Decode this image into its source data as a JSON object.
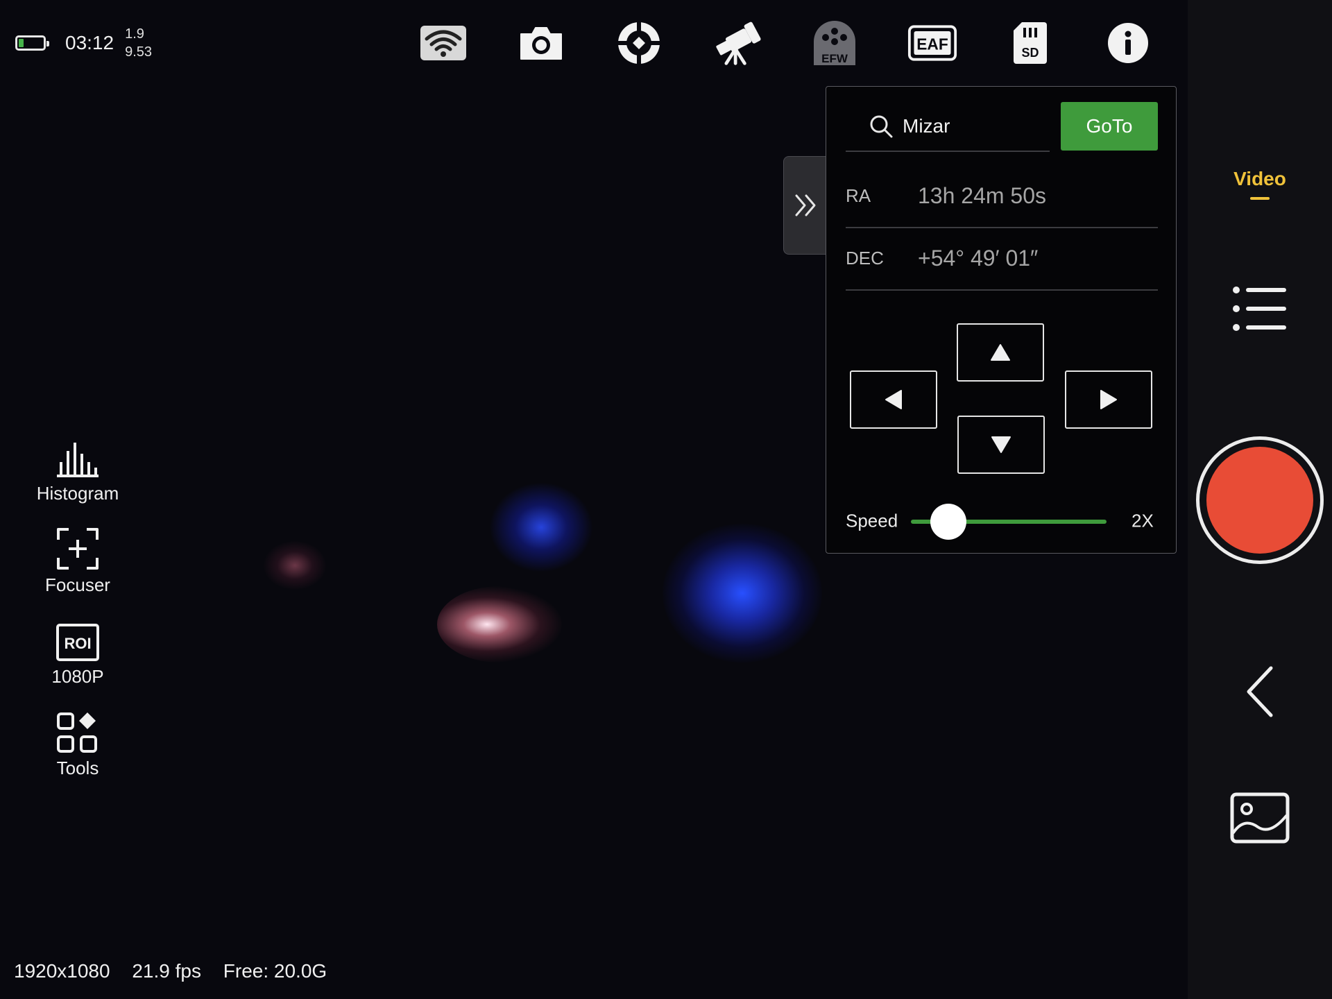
{
  "status": {
    "battery_color": "#46b34a",
    "time": "03:12",
    "stat_top": "1.9",
    "stat_bottom": "9.53"
  },
  "toolbar": {
    "icons": [
      "wifi-icon",
      "camera-icon",
      "guide-crosshair-icon",
      "telescope-icon",
      "filter-wheel-icon",
      "focuser-eaf-icon",
      "sd-card-icon",
      "info-icon"
    ],
    "efw_label": "EFW",
    "eaf_label": "EAF",
    "sd_label": "SD"
  },
  "sidebar": {
    "items": [
      {
        "label": "Histogram",
        "icon": "histogram-icon"
      },
      {
        "label": "Focuser",
        "icon": "focuser-icon"
      },
      {
        "label": "1080P",
        "icon": "roi-icon",
        "badge": "ROI"
      },
      {
        "label": "Tools",
        "icon": "tools-grid-icon"
      }
    ]
  },
  "footer": {
    "resolution": "1920x1080",
    "fps": "21.9 fps",
    "free": "Free: 20.0G"
  },
  "goto_panel": {
    "search_value": "Mizar",
    "goto_label": "GoTo",
    "ra_label": "RA",
    "ra_value": "13h 24m 50s",
    "dec_label": "DEC",
    "dec_value": "+54° 49′ 01″",
    "speed_label": "Speed",
    "speed_value": "2X",
    "speed_fraction": 0.19,
    "accent": "#3f9b3c"
  },
  "right_rail": {
    "mode": "Video",
    "mode_color": "#f0c23a",
    "record_color": "#e84c36"
  }
}
